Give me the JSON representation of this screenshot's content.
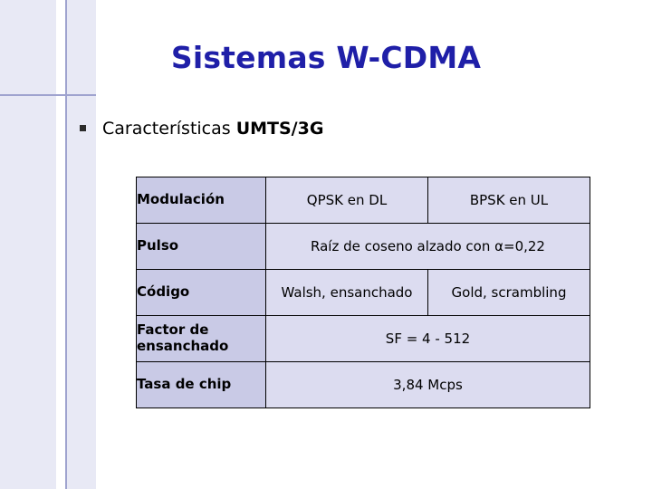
{
  "slide": {
    "title": "Sistemas W-CDMA",
    "bullet": {
      "marker": "square-bullet",
      "text_normal": "Características ",
      "text_bold": "UMTS/3G"
    }
  },
  "table": {
    "rows": [
      {
        "label": "Modulación",
        "cells": [
          {
            "text": "QPSK en DL",
            "colspan": 1
          },
          {
            "text": "BPSK en UL",
            "colspan": 1
          }
        ]
      },
      {
        "label": "Pulso",
        "cells": [
          {
            "text": "Raíz de coseno alzado con α=0,22",
            "colspan": 2
          }
        ]
      },
      {
        "label": "Código",
        "cells": [
          {
            "text": "Walsh, ensanchado",
            "colspan": 1
          },
          {
            "text": "Gold, scrambling",
            "colspan": 1
          }
        ]
      },
      {
        "label": "Factor de ensanchado",
        "cells": [
          {
            "text": "SF = 4 - 512",
            "colspan": 2
          }
        ]
      },
      {
        "label": "Tasa de chip",
        "cells": [
          {
            "text": "3,84 Mcps",
            "colspan": 2
          }
        ]
      }
    ]
  },
  "colors": {
    "title": "#1f1fa8",
    "band": "#e8e9f5",
    "rule": "#9fa3cf",
    "table_label_bg": "#c9cae6",
    "table_value_bg": "#dcdcf0",
    "table_border": "#000000"
  }
}
